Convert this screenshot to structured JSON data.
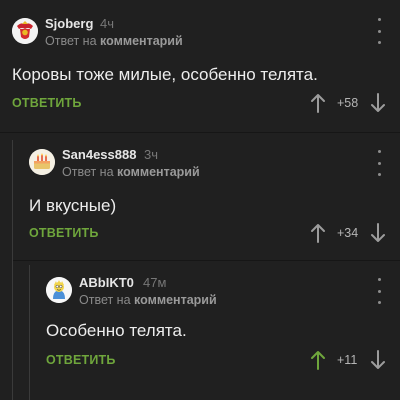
{
  "comments": [
    {
      "username": "Sjoberg",
      "time": "4ч",
      "reply_prefix": "Ответ на",
      "reply_target": "комментарий",
      "text": "Коровы тоже милые, особенно телята.",
      "reply_label": "ОТВЕТИТЬ",
      "rating": "+58",
      "avatar_icon": "coat-of-arms-icon"
    },
    {
      "username": "San4ess888",
      "time": "3ч",
      "reply_prefix": "Ответ на",
      "reply_target": "комментарий",
      "text": "И вкусные)",
      "reply_label": "ОТВЕТИТЬ",
      "rating": "+34",
      "avatar_icon": "cake-icon"
    },
    {
      "username": "ABbIKT0",
      "time": "47м",
      "reply_prefix": "Ответ на",
      "reply_target": "комментарий",
      "text": "Особенно телята.",
      "reply_label": "ОТВЕТИТЬ",
      "rating": "+11",
      "avatar_icon": "cartoon-character-icon"
    }
  ],
  "colors": {
    "background": "#202020",
    "accent_green": "#6fa63c",
    "upvoted_green": "#6fa63c",
    "text": "#ededed",
    "muted": "#8a8a8a"
  }
}
